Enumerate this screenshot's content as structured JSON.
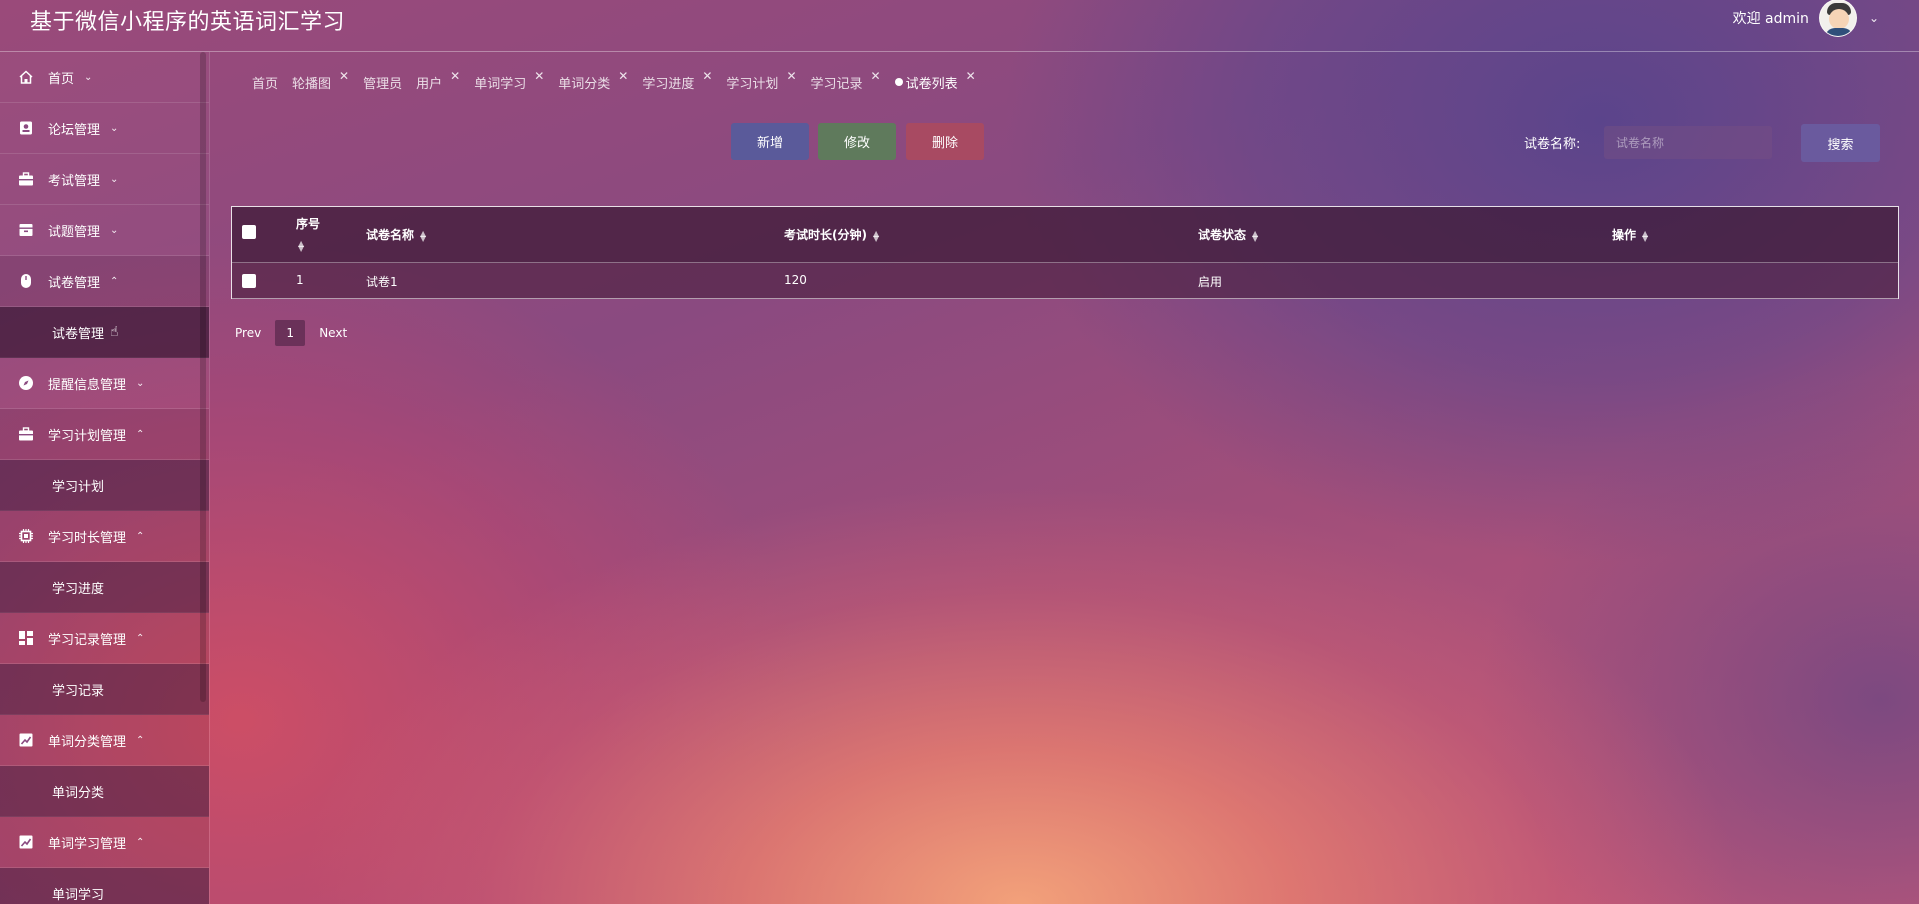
{
  "header": {
    "title": "基于微信小程序的英语词汇学习",
    "welcome": "欢迎 admin"
  },
  "sidebar": {
    "items": [
      {
        "label": "首页",
        "icon": "home-icon",
        "expanded": false
      },
      {
        "label": "论坛管理",
        "icon": "forum-icon",
        "expanded": false
      },
      {
        "label": "考试管理",
        "icon": "briefcase-icon",
        "expanded": false
      },
      {
        "label": "试题管理",
        "icon": "inbox-icon",
        "expanded": false
      },
      {
        "label": "试卷管理",
        "icon": "mouse-icon",
        "expanded": true,
        "children": [
          "试卷管理"
        ]
      },
      {
        "label": "提醒信息管理",
        "icon": "compass-icon",
        "expanded": false
      },
      {
        "label": "学习计划管理",
        "icon": "briefcase-icon",
        "expanded": true,
        "children": [
          "学习计划"
        ]
      },
      {
        "label": "学习时长管理",
        "icon": "chip-icon",
        "expanded": true,
        "children": [
          "学习进度"
        ]
      },
      {
        "label": "学习记录管理",
        "icon": "dashboard-icon",
        "expanded": true,
        "children": [
          "学习记录"
        ]
      },
      {
        "label": "单词分类管理",
        "icon": "chart-icon",
        "expanded": true,
        "children": [
          "单词分类"
        ]
      },
      {
        "label": "单词学习管理",
        "icon": "chart-icon",
        "expanded": true,
        "children": [
          "单词学习"
        ]
      }
    ]
  },
  "tabs": [
    {
      "label": "首页",
      "closable": false,
      "active": false
    },
    {
      "label": "轮播图",
      "closable": true,
      "active": false
    },
    {
      "label": "管理员",
      "closable": false,
      "active": false
    },
    {
      "label": "用户",
      "closable": true,
      "active": false
    },
    {
      "label": "单词学习",
      "closable": true,
      "active": false
    },
    {
      "label": "单词分类",
      "closable": true,
      "active": false
    },
    {
      "label": "学习进度",
      "closable": true,
      "active": false
    },
    {
      "label": "学习计划",
      "closable": true,
      "active": false
    },
    {
      "label": "学习记录",
      "closable": true,
      "active": false
    },
    {
      "label": "试卷列表",
      "closable": true,
      "active": true
    }
  ],
  "toolbar": {
    "add_label": "新增",
    "edit_label": "修改",
    "delete_label": "删除",
    "search_label": "试卷名称:",
    "search_placeholder": "试卷名称",
    "search_value": "",
    "search_button": "搜索"
  },
  "table": {
    "columns": [
      "序号",
      "试卷名称",
      "考试时长(分钟)",
      "试卷状态",
      "操作"
    ],
    "rows": [
      {
        "index": "1",
        "name": "试卷1",
        "duration": "120",
        "status": "启用",
        "actions": ""
      }
    ]
  },
  "pagination": {
    "prev": "Prev",
    "current": "1",
    "next": "Next"
  },
  "colors": {
    "add_button": "#5a5a9a",
    "edit_button": "#5f7a5c",
    "delete_button": "#a84a62",
    "search_button": "#6a5a9e"
  }
}
